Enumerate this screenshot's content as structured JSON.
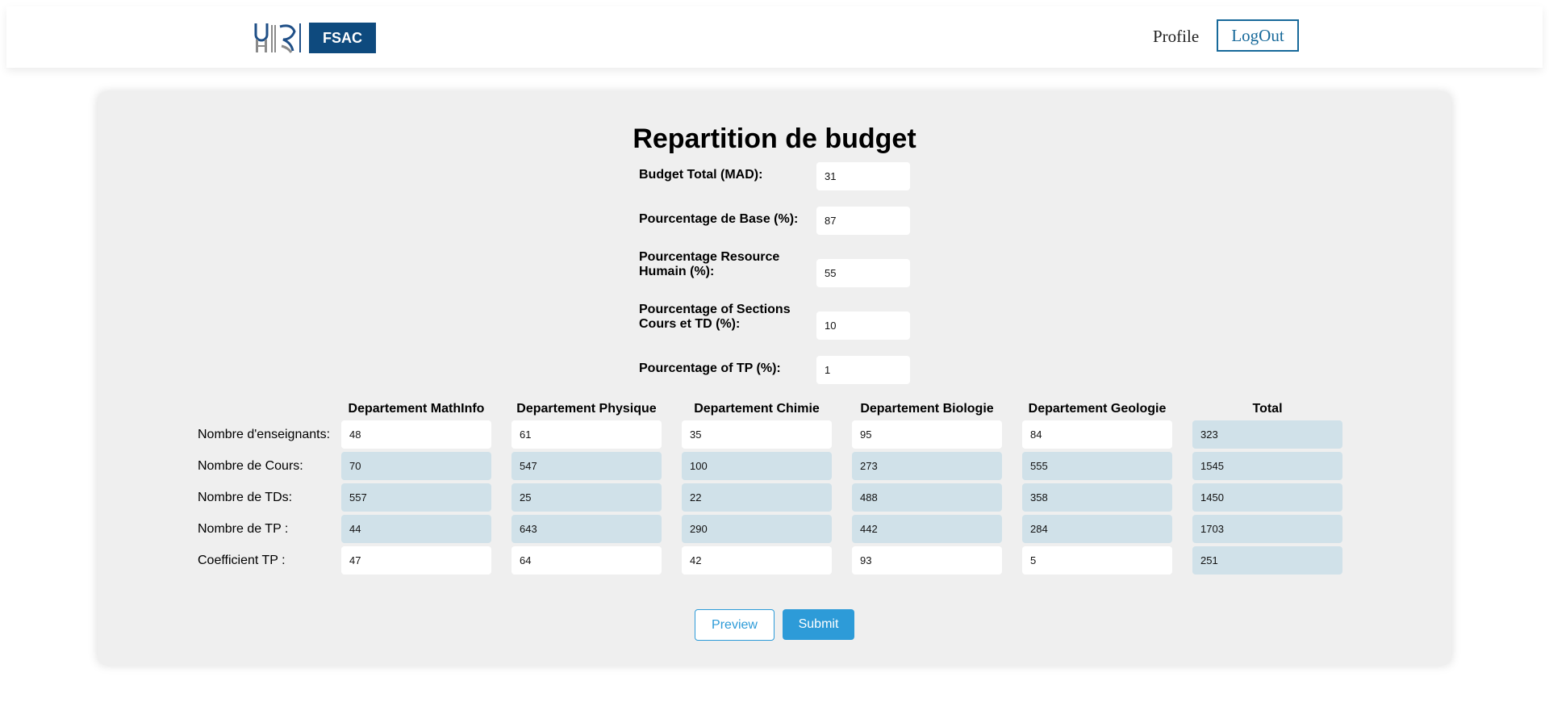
{
  "navbar": {
    "logo_text": "FSAC",
    "logo_colors": {
      "badge": "#0e4a7e",
      "mark_blue": "#1f4f87",
      "mark_gray": "#8a8a8a"
    },
    "profile_label": "Profile",
    "logout_label": "LogOut"
  },
  "page": {
    "title": "Repartition de budget"
  },
  "budget_fields": [
    {
      "label": "Budget Total (MAD):",
      "value": "31"
    },
    {
      "label": "Pourcentage de Base (%):",
      "value": "87"
    },
    {
      "label": "Pourcentage Resource Humain (%):",
      "value": "55"
    },
    {
      "label": "Pourcentage of Sections Cours et TD (%):",
      "value": "10"
    },
    {
      "label": "Pourcentage of TP (%):",
      "value": "1"
    }
  ],
  "table": {
    "columns": [
      "Departement MathInfo",
      "Departement Physique",
      "Departement Chimie",
      "Departement Biologie",
      "Departement Geologie",
      "Total"
    ],
    "rows": [
      {
        "label": "Nombre d'enseignants:",
        "editable": true,
        "values": [
          "48",
          "61",
          "35",
          "95",
          "84",
          "323"
        ]
      },
      {
        "label": "Nombre de Cours:",
        "editable": false,
        "values": [
          "70",
          "547",
          "100",
          "273",
          "555",
          "1545"
        ]
      },
      {
        "label": "Nombre de TDs:",
        "editable": false,
        "values": [
          "557",
          "25",
          "22",
          "488",
          "358",
          "1450"
        ]
      },
      {
        "label": "Nombre de TP :",
        "editable": false,
        "values": [
          "44",
          "643",
          "290",
          "442",
          "284",
          "1703"
        ]
      },
      {
        "label": "Coefficient TP :",
        "editable": true,
        "values": [
          "47",
          "64",
          "42",
          "93",
          "5",
          "251"
        ]
      }
    ]
  },
  "actions": {
    "preview_label": "Preview",
    "submit_label": "Submit",
    "accent_color": "#2d9bd8"
  }
}
